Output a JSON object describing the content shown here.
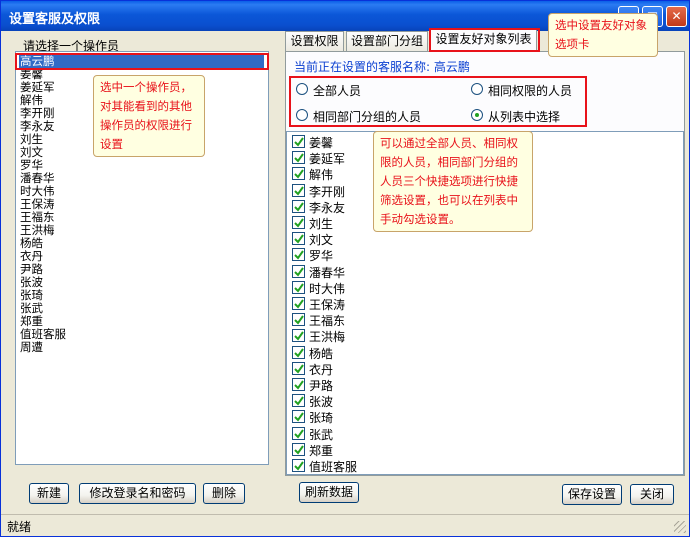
{
  "window": {
    "title": "设置客服及权限"
  },
  "title_buttons": {
    "minimize": "_",
    "maximize": "□",
    "close": "✕"
  },
  "left": {
    "label": "请选择一个操作员",
    "operators": [
      "高云鹏",
      "姜馨",
      "姜延军",
      "解伟",
      "李开刚",
      "李永友",
      "刘生",
      "刘文",
      "罗华",
      "潘春华",
      "时大伟",
      "王保涛",
      "王福东",
      "王洪梅",
      "杨皓",
      "衣丹",
      "尹路",
      "张波",
      "张琦",
      "张武",
      "郑重",
      "值班客服",
      "周遭"
    ],
    "selected_index": 0,
    "buttons": {
      "new": "新建",
      "edit_login": "修改登录名和密码",
      "delete": "删除"
    }
  },
  "tabs": [
    "设置权限",
    "设置部门分组",
    "设置友好对象列表"
  ],
  "active_tab": 2,
  "current_label": "当前正在设置的客服名称: 高云鹏",
  "radios": {
    "all": "全部人员",
    "same_perm": "相同权限的人员",
    "same_dept": "相同部门分组的人员",
    "from_list": "从列表中选择",
    "selected": "from_list"
  },
  "checklist": [
    "姜馨",
    "姜延军",
    "解伟",
    "李开刚",
    "李永友",
    "刘生",
    "刘文",
    "罗华",
    "潘春华",
    "时大伟",
    "王保涛",
    "王福东",
    "王洪梅",
    "杨皓",
    "衣丹",
    "尹路",
    "张波",
    "张琦",
    "张武",
    "郑重",
    "值班客服"
  ],
  "bottom_buttons": {
    "refresh": "刷新数据",
    "save": "保存设置",
    "close": "关闭"
  },
  "callouts": {
    "tab": "选中设置友好对象选项卡",
    "operator": "选中一个操作员，对其能看到的其他操作员的权限进行设置",
    "filter": "可以通过全部人员、相同权限的人员，相同部门分组的人员三个快捷选项进行快捷筛选设置，也可以在列表中手动勾选设置。"
  },
  "status": "就绪",
  "colors": {
    "highlight": "#e8121a",
    "selection": "#316ac5",
    "title_bar": "#0a57d8",
    "check": "#21a121"
  }
}
